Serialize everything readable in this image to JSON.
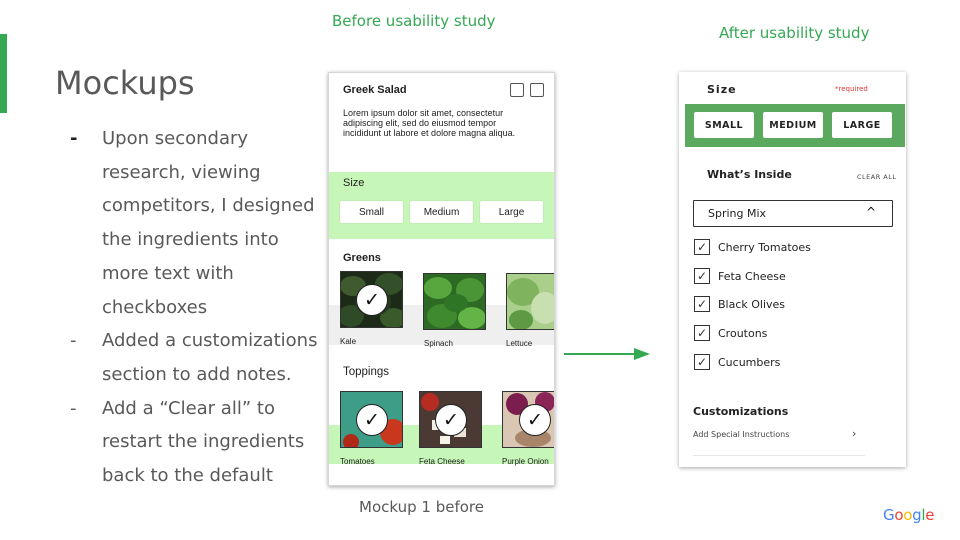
{
  "slide": {
    "title": "Mockups",
    "accent_color": "#34a853",
    "bullets": [
      {
        "marker": "-",
        "text": "Upon secondary research, viewing competitors, I designed the ingredients into more text with checkboxes"
      },
      {
        "marker": "-",
        "text": "Added a customizations section to add notes."
      },
      {
        "marker": "-",
        "text": "Add a “Clear all” to restart the ingredients back to the default"
      }
    ],
    "captions": {
      "before": "Before usability study",
      "after": "After usability study",
      "mockup": "Mockup 1 before"
    },
    "logo_text": [
      "G",
      "o",
      "o",
      "g",
      "l",
      "e"
    ],
    "logo_colors": [
      "#4285f4",
      "#ea4335",
      "#fbbc05",
      "#4285f4",
      "#34a853",
      "#ea4335"
    ]
  },
  "before_mockup": {
    "title": "Greek Salad",
    "description": "Lorem ipsum dolor sit amet, consectetur adipiscing elit, sed do eiusmod tempor incididunt ut labore et dolore magna aliqua.",
    "size_label": "Size",
    "sizes": [
      "Small",
      "Medium",
      "Large"
    ],
    "greens_label": "Greens",
    "greens": [
      {
        "label": "Kale",
        "checked": true
      },
      {
        "label": "Spinach",
        "checked": false
      },
      {
        "label": "Lettuce",
        "checked": false
      }
    ],
    "toppings_label": "Toppings",
    "toppings": [
      {
        "label": "Tomatoes",
        "checked": true
      },
      {
        "label": "Feta Cheese",
        "checked": true
      },
      {
        "label": "Purple Onion",
        "checked": true
      }
    ],
    "band_color": "#c6f6b8"
  },
  "after_mockup": {
    "size_label": "Size",
    "required_text": "*required",
    "sizes": [
      "SMALL",
      "MEDIUM",
      "LARGE"
    ],
    "inside_label": "What’s Inside",
    "clear_all": "CLEAR ALL",
    "select_value": "Spring Mix",
    "ingredients": [
      {
        "label": "Cherry Tomatoes",
        "checked": true
      },
      {
        "label": "Feta Cheese",
        "checked": true
      },
      {
        "label": "Black Olives",
        "checked": true
      },
      {
        "label": "Croutons",
        "checked": true
      },
      {
        "label": "Cucumbers",
        "checked": true
      }
    ],
    "customizations_label": "Customizations",
    "instructions_text": "Add Special Instructions",
    "band_color": "#5aa95f",
    "required_color": "#e53935"
  }
}
